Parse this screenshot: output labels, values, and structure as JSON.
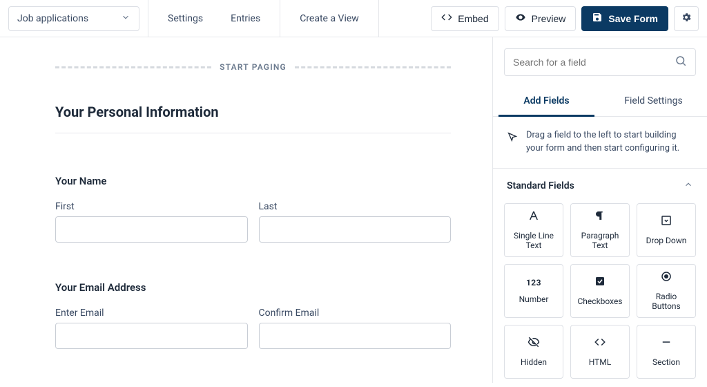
{
  "topbar": {
    "form_name": "Job applications",
    "nav": {
      "settings": "Settings",
      "entries": "Entries",
      "create_view": "Create a View"
    },
    "embed": "Embed",
    "preview": "Preview",
    "save": "Save Form"
  },
  "canvas": {
    "paging_label": "START PAGING",
    "section_title": "Your Personal Information",
    "name": {
      "title": "Your Name",
      "first": "First",
      "last": "Last"
    },
    "email": {
      "title": "Your Email Address",
      "enter": "Enter Email",
      "confirm": "Confirm Email"
    }
  },
  "sidebar": {
    "search_placeholder": "Search for a field",
    "tabs": {
      "add": "Add Fields",
      "settings": "Field Settings"
    },
    "hint": "Drag a field to the left to start building your form and then start configuring it.",
    "group_title": "Standard Fields",
    "fields": {
      "single_line": "Single Line Text",
      "paragraph": "Paragraph Text",
      "dropdown": "Drop Down",
      "number": "Number",
      "number_icon": "123",
      "checkboxes": "Checkboxes",
      "radio": "Radio Buttons",
      "hidden": "Hidden",
      "html": "HTML",
      "section": "Section"
    }
  }
}
